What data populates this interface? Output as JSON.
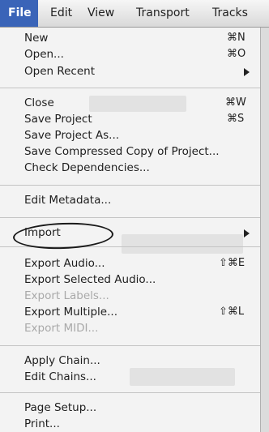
{
  "menubar": {
    "items": [
      "File",
      "Edit",
      "View",
      "Transport",
      "Tracks"
    ]
  },
  "menu": {
    "items": [
      {
        "label": "New",
        "shortcut": "⌘N"
      },
      {
        "label": "Open...",
        "shortcut": "⌘O"
      },
      {
        "label": "Open Recent",
        "submenu": true
      },
      {
        "label": "Close",
        "shortcut": "⌘W"
      },
      {
        "label": "Save Project",
        "shortcut": "⌘S"
      },
      {
        "label": "Save Project As..."
      },
      {
        "label": "Save Compressed Copy of Project..."
      },
      {
        "label": "Check Dependencies..."
      },
      {
        "label": "Edit Metadata..."
      },
      {
        "label": "Import",
        "submenu": true
      },
      {
        "label": "Export Audio...",
        "shortcut": "⇧⌘E",
        "circled": true
      },
      {
        "label": "Export Selected Audio..."
      },
      {
        "label": "Export Labels...",
        "disabled": true
      },
      {
        "label": "Export Multiple...",
        "shortcut": "⇧⌘L"
      },
      {
        "label": "Export MIDI...",
        "disabled": true
      },
      {
        "label": "Apply Chain..."
      },
      {
        "label": "Edit Chains..."
      },
      {
        "label": "Page Setup..."
      },
      {
        "label": "Print..."
      }
    ]
  },
  "colors": {
    "active_menu_bg": "#3a64b8",
    "menu_bg": "#f3f3f3",
    "disabled_text": "#a9a9a9"
  }
}
